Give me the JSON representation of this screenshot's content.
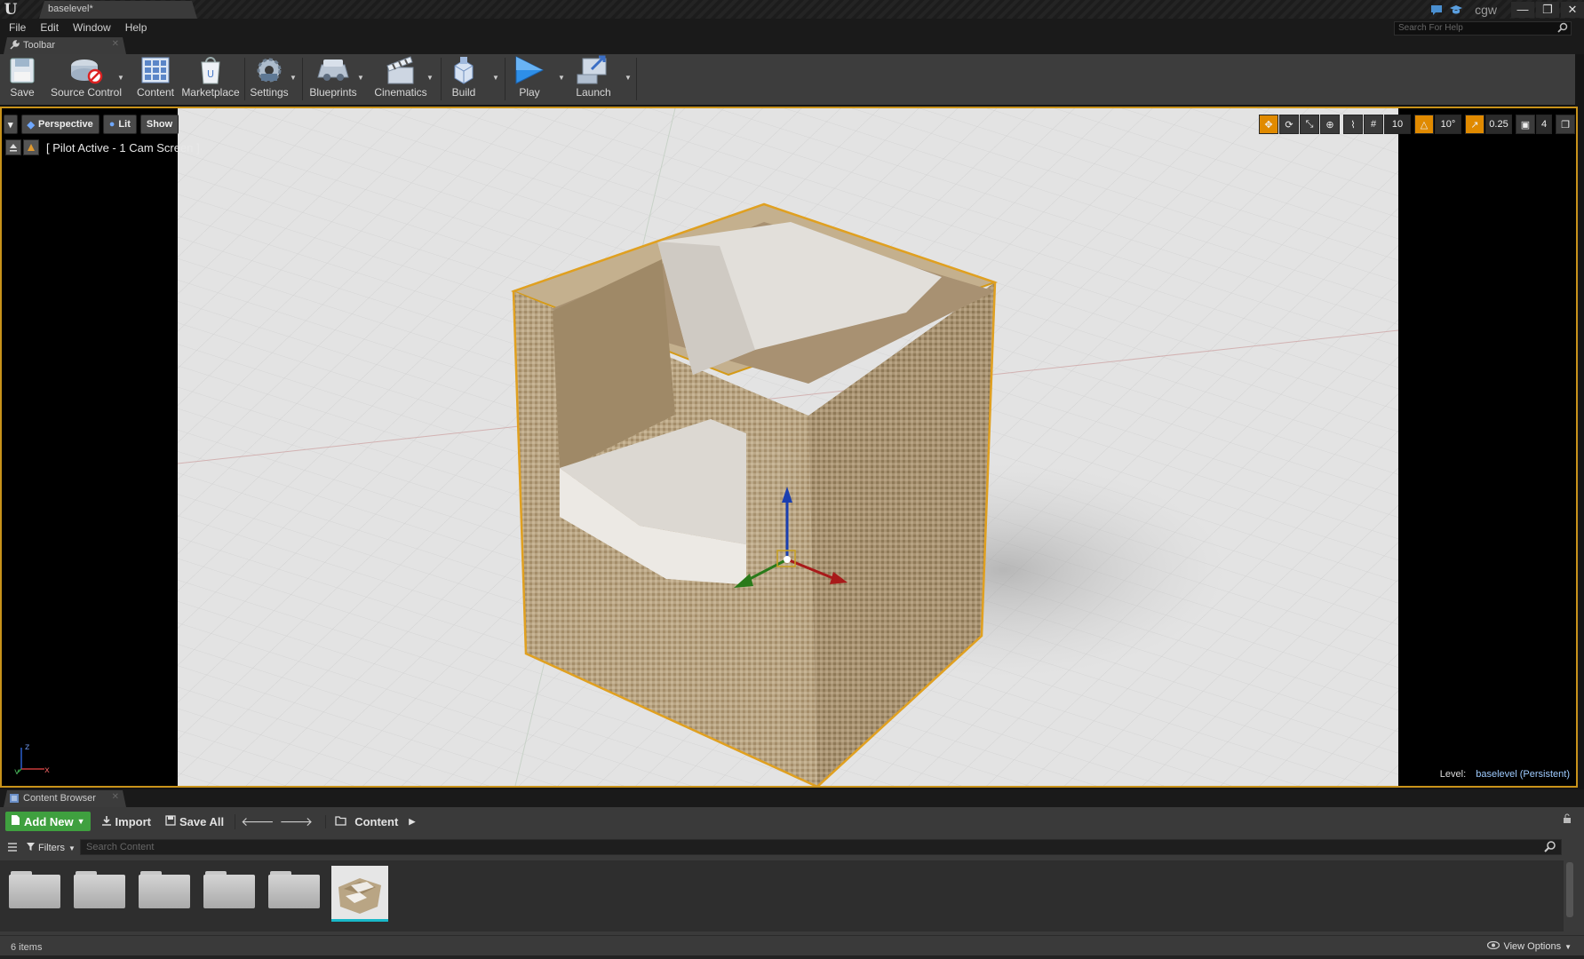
{
  "window": {
    "doc_tab": "baselevel*",
    "user": "cgw",
    "controls": [
      "—",
      "❐",
      "✕"
    ]
  },
  "menu": {
    "items": [
      "File",
      "Edit",
      "Window",
      "Help"
    ],
    "search_placeholder": "Search For Help"
  },
  "toolbar_tab": {
    "label": "Toolbar"
  },
  "toolbar": {
    "buttons": [
      {
        "label": "Save",
        "icon": "save-icon"
      },
      {
        "label": "Source Control",
        "icon": "source-control-icon"
      },
      {
        "label": "Content",
        "icon": "content-icon"
      },
      {
        "label": "Marketplace",
        "icon": "marketplace-icon"
      },
      {
        "label": "Settings",
        "icon": "settings-icon"
      },
      {
        "label": "Blueprints",
        "icon": "blueprints-icon"
      },
      {
        "label": "Cinematics",
        "icon": "cinematics-icon"
      },
      {
        "label": "Build",
        "icon": "build-icon"
      },
      {
        "label": "Play",
        "icon": "play-icon"
      },
      {
        "label": "Launch",
        "icon": "launch-icon"
      }
    ]
  },
  "viewport": {
    "perspective": "Perspective",
    "lit": "Lit",
    "show": "Show",
    "pilot": "[ Pilot Active - 1 Cam Screen ]",
    "grid_snap": "10",
    "rot_snap": "10°",
    "scale_snap": "0.25",
    "cam_speed": "4",
    "level_key": "Level:",
    "level_value": "baselevel (Persistent)",
    "colors": {
      "selection": "#c8921a",
      "floor": "#e2e2e2",
      "wicker": "#b19c7a",
      "cushion": "#dcd9d4"
    }
  },
  "content_browser": {
    "tab": "Content Browser",
    "add_new": "Add New",
    "import": "Import",
    "save_all": "Save All",
    "path": "Content",
    "filters": "Filters",
    "search_placeholder": "Search Content",
    "items_count": "6 items",
    "view_options": "View Options",
    "assets": [
      "folder",
      "folder",
      "folder",
      "folder",
      "folder",
      "chair-mesh"
    ]
  }
}
